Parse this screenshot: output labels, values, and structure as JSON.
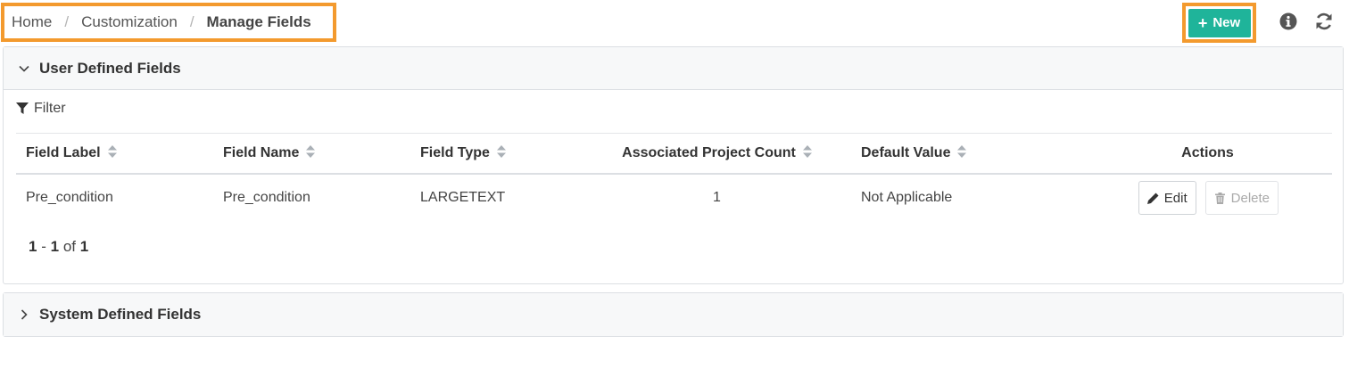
{
  "breadcrumb": {
    "home": "Home",
    "customization": "Customization",
    "current": "Manage Fields",
    "separator": "/"
  },
  "toolbar": {
    "new_label": "New",
    "new_color": "#1fb49a",
    "highlight_color": "#f39a2e",
    "info_icon": "info-circle-icon",
    "refresh_icon": "refresh-icon"
  },
  "user_fields": {
    "title": "User Defined Fields",
    "expanded": true,
    "filter_label": "Filter",
    "columns": [
      "Field Label",
      "Field Name",
      "Field Type",
      "Associated Project Count",
      "Default Value",
      "Actions"
    ],
    "rows": [
      {
        "field_label": "Pre_condition",
        "field_name": "Pre_condition",
        "field_type": "LARGETEXT",
        "project_count": "1",
        "default_value": "Not Applicable",
        "edit_label": "Edit",
        "delete_label": "Delete"
      }
    ],
    "pager": {
      "start": "1",
      "dash": "-",
      "end": "1",
      "of": "of",
      "total": "1"
    }
  },
  "system_fields": {
    "title": "System Defined Fields",
    "expanded": false
  }
}
